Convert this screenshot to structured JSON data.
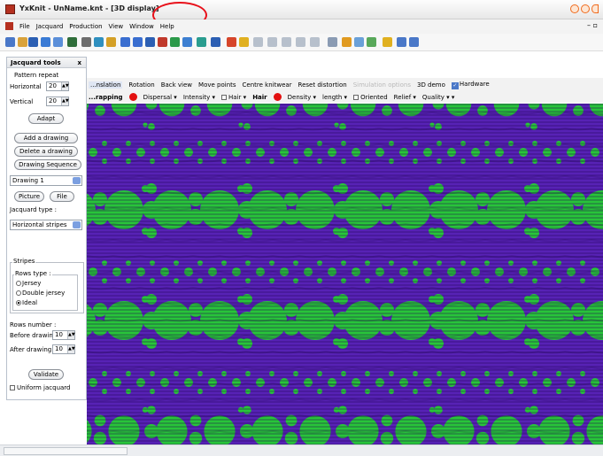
{
  "app": {
    "title": "YxKnit - UnName.knt - [3D display]"
  },
  "menu": [
    "File",
    "Jacquard",
    "Production",
    "View",
    "Window",
    "Help"
  ],
  "toolbar_icons": [
    "new-icon",
    "open-icon",
    "save-icon",
    "print-icon",
    "print-preview-icon",
    "grid-icon",
    "sheet-icon",
    "wand-icon",
    "link-icon",
    "zoom-in-icon",
    "zoom-out-icon",
    "save-icon",
    "palette-icon",
    "stitch-icon",
    "chart-icon",
    "layout-icon",
    "crop-icon",
    "pen-icon",
    "bulb-icon",
    "pattern-a-icon",
    "pattern-b-icon",
    "pattern-c-icon",
    "pattern-d-icon",
    "pattern-e-icon",
    "pointer-icon",
    "user-icon",
    "image-icon",
    "grid-view-icon",
    "bars-icon",
    "window-icon",
    "split-icon"
  ],
  "sim_toolbar": {
    "items": [
      "...nslation",
      "Rotation",
      "Back view",
      "Move points",
      "Centre knitwear",
      "Reset distortion",
      "Simulation options",
      "3D demo",
      "Hardware"
    ],
    "disabled_index": 6
  },
  "texture_toolbar": {
    "wrapping": "...rapping",
    "dispersal": "Dispersal",
    "intensity": "Intensity",
    "hair": "Hair",
    "hair_bold": "Hair",
    "density": "Density",
    "length": "length",
    "oriented": "Oriented",
    "relief": "Relief",
    "quality": "Quality"
  },
  "jacquard_tools": {
    "title": "Jacquard tools",
    "close": "x",
    "pattern_repeat": "Pattern repeat",
    "horizontal_label": "Horizontal",
    "horizontal_value": "20",
    "vertical_label": "Vertical",
    "vertical_value": "20",
    "adapt": "Adapt",
    "add_drawing": "Add a drawing",
    "delete_drawing": "Delete a drawing",
    "drawing_sequence": "Drawing Sequence",
    "drawing_select": "Drawing 1",
    "picture": "Picture",
    "file": "File",
    "jacquard_type_label": "Jacquard type :",
    "jacquard_type_value": "Horizontal stripes",
    "stripes": "Stripes",
    "rows_type": "Rows type :",
    "jersey": "Jersey",
    "double_jersey": "Double jersey",
    "ideal": "Ideal",
    "selected_rows_type": "Ideal",
    "rows_number": "Rows number :",
    "before_label": "Before drawing",
    "before_value": "10",
    "after_label": "After drawing",
    "after_value": "10",
    "validate": "Validate",
    "uniform": "Uniform jacquard"
  },
  "colors": {
    "background_purple": "#5722b5",
    "dots_green": "#28c43a",
    "accent_red": "#e31010"
  }
}
